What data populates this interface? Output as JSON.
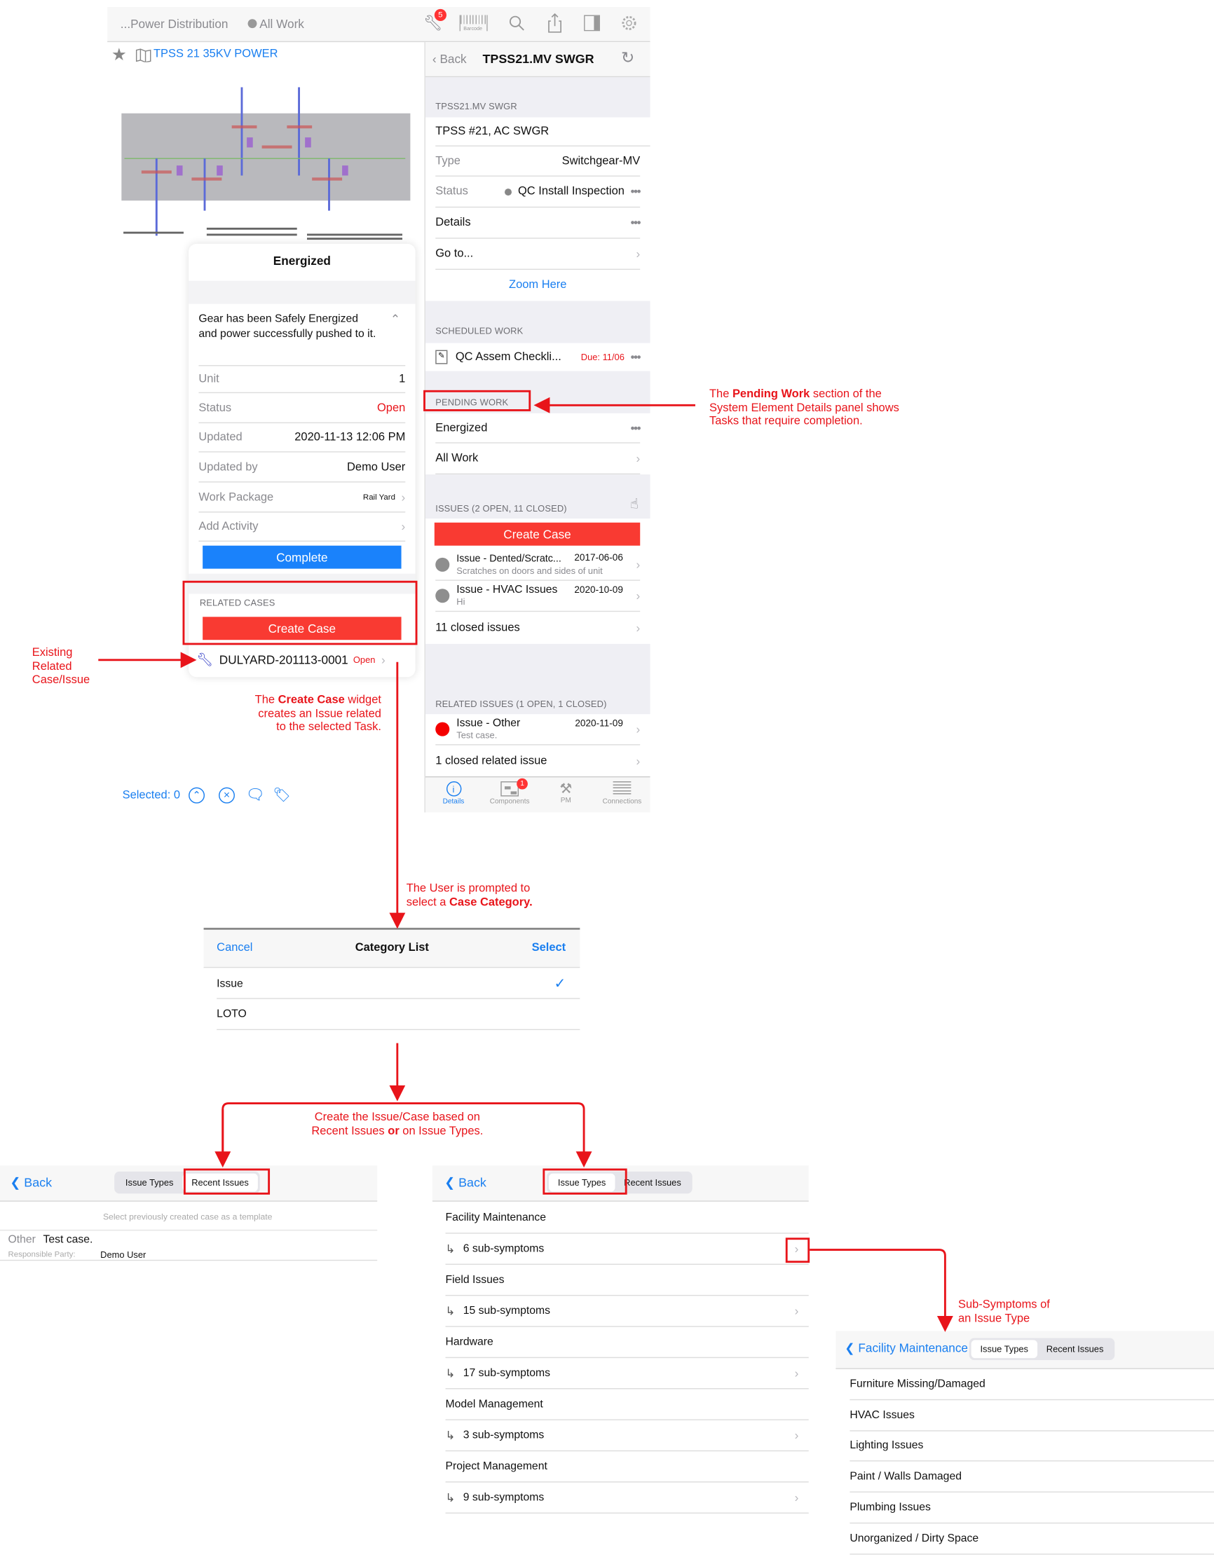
{
  "topbar": {
    "breadcrumb": "...Power Distribution",
    "filter": "All Work",
    "badge": "5",
    "barcode_label": "Barcode",
    "icons": [
      "wrench-icon",
      "barcode-icon",
      "search-icon",
      "share-icon",
      "sidebar-icon",
      "gear-icon"
    ]
  },
  "drawing": {
    "title": "TPSS 21 35KV POWER"
  },
  "popup": {
    "title": "Energized",
    "description": "Gear has been Safely Energized and power successfully pushed to it.",
    "rows": [
      {
        "label": "Unit",
        "value": "1"
      },
      {
        "label": "Status",
        "value": "Open"
      },
      {
        "label": "Updated",
        "value": "2020-11-13 12:06 PM"
      },
      {
        "label": "Updated by",
        "value": "Demo User"
      },
      {
        "label": "Work Package",
        "value": "Rail Yard"
      },
      {
        "label": "Add Activity",
        "value": ""
      }
    ],
    "complete_label": "Complete",
    "related_header": "RELATED CASES",
    "create_case_label": "Create Case",
    "case_id": "DULYARD-201113-0001",
    "case_status": "Open"
  },
  "selection": {
    "label": "Selected: 0"
  },
  "details": {
    "back": "Back",
    "title": "TPSS21.MV SWGR",
    "section_label": "TPSS21.MV SWGR",
    "name": "TPSS #21, AC SWGR",
    "type_label": "Type",
    "type_value": "Switchgear-MV",
    "status_label": "Status",
    "status_value": "QC Install Inspection",
    "details_label": "Details",
    "goto_label": "Go to...",
    "zoom_label": "Zoom Here",
    "scheduled_header": "SCHEDULED WORK",
    "scheduled_item": "QC Assem Checkli...",
    "scheduled_due": "Due: 11/06",
    "pending_header": "PENDING WORK",
    "pending_items": [
      "Energized",
      "All Work"
    ],
    "issues_header": "ISSUES (2 OPEN, 11 CLOSED)",
    "create_case_label": "Create Case",
    "issues": [
      {
        "title": "Issue - Dented/Scratc...",
        "date": "2017-06-06",
        "sub": "Scratches on doors and sides of unit",
        "color": "#8e8e8e"
      },
      {
        "title": "Issue - HVAC Issues",
        "date": "2020-10-09",
        "sub": "Hi",
        "color": "#8e8e8e"
      }
    ],
    "closed_issues": "11 closed issues",
    "related_header": "RELATED ISSUES (1 OPEN, 1 CLOSED)",
    "related": [
      {
        "title": "Issue - Other",
        "date": "2020-11-09",
        "sub": "Test case.",
        "color": "#f40000"
      }
    ],
    "closed_related": "1 closed related issue",
    "tabs": [
      {
        "label": "Details",
        "badge": ""
      },
      {
        "label": "Components",
        "badge": "1"
      },
      {
        "label": "PM",
        "badge": ""
      },
      {
        "label": "Connections",
        "badge": ""
      }
    ]
  },
  "category": {
    "cancel": "Cancel",
    "title": "Category List",
    "select": "Select",
    "items": [
      {
        "label": "Issue",
        "checked": true
      },
      {
        "label": "LOTO",
        "checked": false
      }
    ]
  },
  "recent": {
    "back": "Back",
    "seg": [
      "Issue Types",
      "Recent Issues"
    ],
    "hint": "Select previously created case as a template",
    "item_type": "Other",
    "item_title": "Test case.",
    "party_label": "Responsible Party:",
    "party_value": "Demo User"
  },
  "types": {
    "back": "Back",
    "seg": [
      "Issue Types",
      "Recent Issues"
    ],
    "groups": [
      {
        "name": "Facility Maintenance",
        "sub": "6 sub-symptoms"
      },
      {
        "name": "Field Issues",
        "sub": "15 sub-symptoms"
      },
      {
        "name": "Hardware",
        "sub": "17 sub-symptoms"
      },
      {
        "name": "Model Management",
        "sub": "3 sub-symptoms"
      },
      {
        "name": "Project Management",
        "sub": "9 sub-symptoms"
      }
    ]
  },
  "subs": {
    "back": "Facility Maintenance",
    "seg": [
      "Issue Types",
      "Recent Issues"
    ],
    "items": [
      "Furniture Missing/Damaged",
      "HVAC Issues",
      "Lighting Issues",
      "Paint / Walls Damaged",
      "Plumbing Issues",
      "Unorganized / Dirty Space"
    ]
  },
  "annotations": {
    "existing": [
      "Existing",
      "Related",
      "Case/Issue"
    ],
    "create_case": {
      "pre": "The ",
      "bold": "Create Case",
      "post": " widget",
      "l2": "creates an Issue related",
      "l3": "to the selected Task."
    },
    "pending": {
      "pre": "The ",
      "bold": "Pending Work",
      "post": " section of the",
      "l2": "System Element Details panel shows",
      "l3": "Tasks that require completion."
    },
    "category": {
      "l1": "The User is prompted to",
      "pre": "select a ",
      "bold": "Case Category."
    },
    "based": {
      "l1": "Create the Issue/Case based on",
      "pre": "Recent Issues ",
      "bold": "or",
      "post": " on Issue Types."
    },
    "subsym": {
      "l1": "Sub-Symptoms of",
      "l2": "an Issue Type"
    }
  },
  "colors": {
    "accent": "#1a7ff0",
    "danger": "#f93a32",
    "annotation": "#e8141a"
  }
}
